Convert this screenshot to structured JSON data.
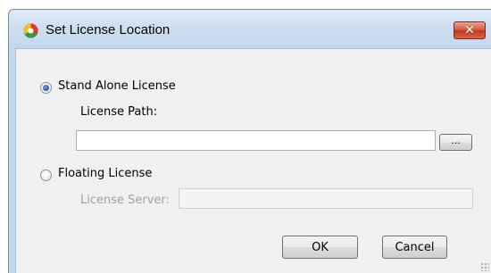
{
  "window": {
    "title": "Set License Location",
    "close_label": "✕"
  },
  "stand_alone": {
    "label": "Stand Alone License",
    "selected": true,
    "path_label": "License Path:",
    "path_value": "",
    "browse_label": "..."
  },
  "floating": {
    "label": "Floating License",
    "selected": false,
    "server_label": "License Server:",
    "server_value": ""
  },
  "buttons": {
    "ok": "OK",
    "cancel": "Cancel"
  },
  "colors": {
    "title_bar": "#c4d8ee",
    "close_button": "#c0391a",
    "client_bg": "#f0f0f0",
    "radio_selected": "#1f4fa3",
    "disabled_text": "#a0a0a0"
  }
}
